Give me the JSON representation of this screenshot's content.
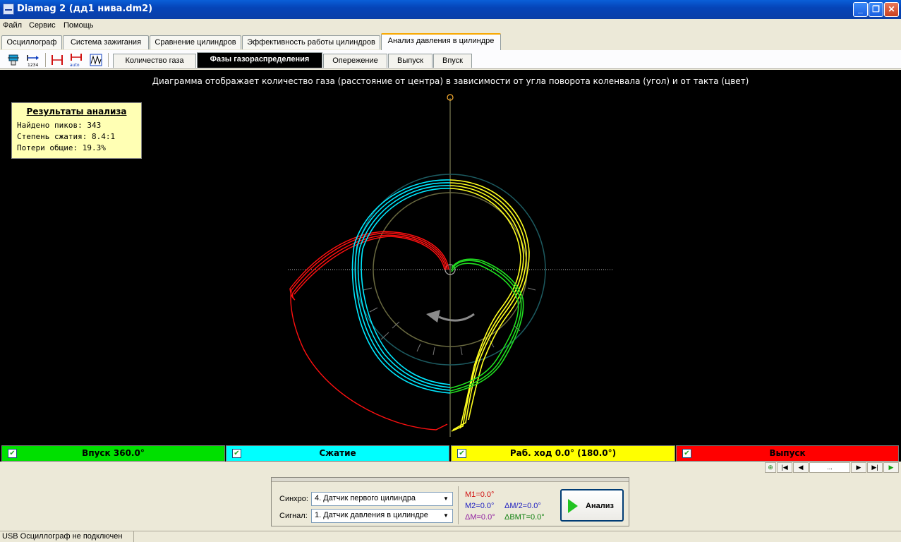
{
  "window": {
    "title": "Diamag 2 (дд1 нива.dm2)",
    "minimize_glyph": "_",
    "maximize_glyph": "❐",
    "close_glyph": "✕"
  },
  "menu": {
    "items": [
      {
        "label": "Файл"
      },
      {
        "label": "Сервис"
      },
      {
        "label": "Помощь"
      }
    ]
  },
  "main_tabs": [
    {
      "label": "Осциллограф",
      "active": false
    },
    {
      "label": "Система зажигания",
      "active": false
    },
    {
      "label": "Сравнение цилиндров",
      "active": false
    },
    {
      "label": "Эффективность работы цилиндров",
      "active": false
    },
    {
      "label": "Анализ давления в цилиндре",
      "active": true
    }
  ],
  "toolbar": {
    "icons": [
      "cylinder-sensor-icon",
      "numbering-icon",
      "marker-icon",
      "auto-marker-icon",
      "waveform-icon"
    ]
  },
  "sub_tabs": [
    {
      "label": "Количество газа",
      "active": false
    },
    {
      "label": "Фазы газораспределения",
      "active": true
    },
    {
      "label": "Опережение",
      "active": false
    },
    {
      "label": "Выпуск",
      "active": false
    },
    {
      "label": "Впуск",
      "active": false
    }
  ],
  "plot": {
    "caption": "Диаграмма отображает количество газа (расстояние от центра) в зависимости от угла поворота коленвала (угол) и от такта (цвет)",
    "colors": {
      "intake": "#00ff00",
      "compression": "#00ffff",
      "power": "#ffff00",
      "exhaust": "#ff0000",
      "background": "#000000"
    }
  },
  "results": {
    "title": "Результаты анализа",
    "peaks": "Найдено пиков: 343",
    "compression": "Степень сжатия: 8.4:1",
    "losses": "Потери общие: 19.3%"
  },
  "legend": [
    {
      "label": "Впуск 360.0°",
      "color": "#00e000",
      "checked": true
    },
    {
      "label": "Сжатие",
      "color": "#00ffff",
      "checked": true
    },
    {
      "label": "Раб. ход 0.0° (180.0°)",
      "color": "#ffff00",
      "checked": true
    },
    {
      "label": "Выпуск",
      "color": "#ff0000",
      "checked": true
    }
  ],
  "nav": {
    "add": "⊕",
    "first": "|◀",
    "prev": "◀",
    "middle": "...",
    "next": "▶",
    "last": "▶|",
    "play": "▶"
  },
  "controls": {
    "sync_label": "Синхро:",
    "sync_value": "4.  Датчик первого цилиндра",
    "signal_label": "Сигнал:",
    "signal_value": "1.  Датчик давления в цилиндре",
    "m1": "M1=0.0°",
    "m2": "M2=0.0°",
    "dm": "ΔM=0.0°",
    "dm2": "ΔM/2=0.0°",
    "dbmt": "ΔBMT=0.0°",
    "analyze_label": "Анализ"
  },
  "status": {
    "text": "USB Осциллограф не подключен"
  }
}
